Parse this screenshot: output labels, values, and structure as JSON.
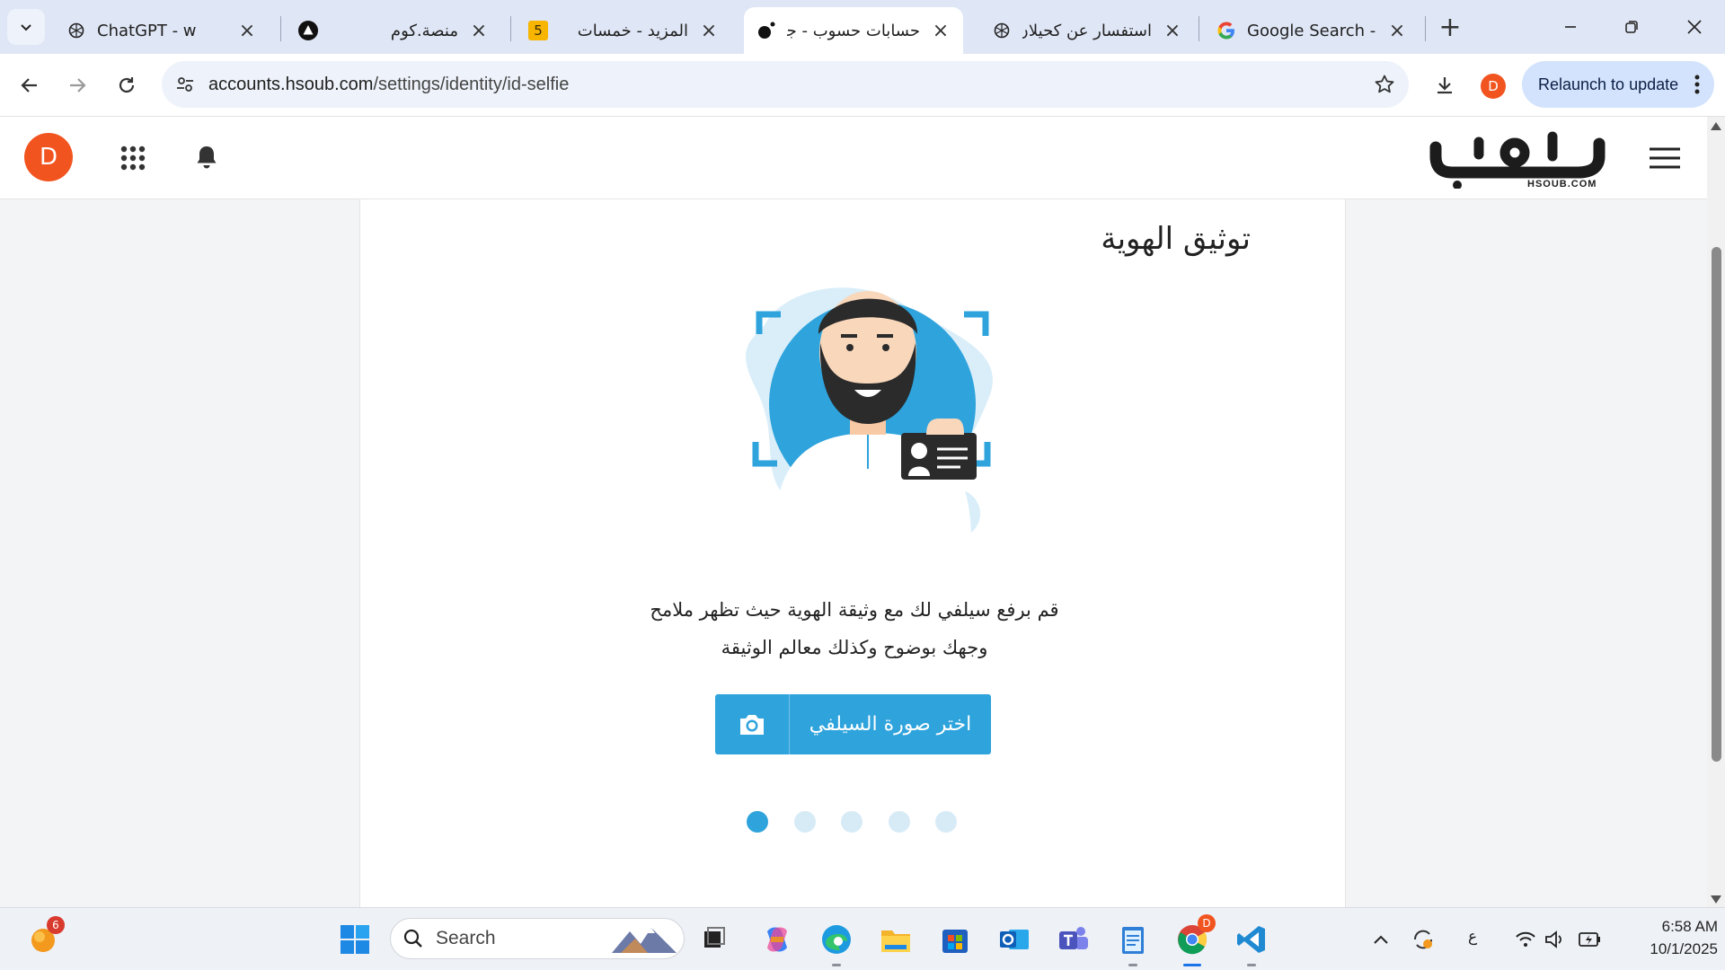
{
  "browser": {
    "tabs": [
      {
        "title": "ChatGPT - w",
        "favicon": "chatgpt-icon",
        "rtl": false,
        "active": false
      },
      {
        "title": "منصة.كوم",
        "favicon": "triangle-logo-icon",
        "rtl": true,
        "active": false
      },
      {
        "title": "المزيد - خمسات",
        "favicon": "khamsat-icon",
        "favicon_text": "5",
        "rtl": true,
        "active": false
      },
      {
        "title": "حسابات حسوب - جـ",
        "favicon": "hsoub-icon",
        "rtl": true,
        "active": true
      },
      {
        "title": "استفسار عن كحيلان",
        "favicon": "chatgpt-icon",
        "rtl": true,
        "active": false
      },
      {
        "title": "Google Search - ي",
        "favicon": "google-icon",
        "rtl": false,
        "active": false
      }
    ],
    "url_host": "accounts.hsoub.com",
    "url_path": "/settings/identity/id-selfie",
    "profile_initial": "D",
    "relaunch_label": "Relaunch to update",
    "accent": "#d3e3fd"
  },
  "site": {
    "user_initial": "D",
    "avatar_color": "#f1541f",
    "logo_text": "HSOUB.COM",
    "brand_color": "#2ea3dc"
  },
  "main": {
    "title": "توثيق الهوية",
    "description_line1": "قم برفع سيلفي لك مع وثيقة الهوية حيث تظهر ملامح",
    "description_line2": "وجهك بوضوح وكذلك معالم الوثيقة",
    "select_button_label": "اختر صورة السيلفي",
    "steps_total": 5,
    "current_step": 1
  },
  "taskbar": {
    "search_placeholder": "Search",
    "notification_badge": "6",
    "chrome_badge": "D",
    "language": "ع",
    "time": "6:58 AM",
    "date": "10/1/2025"
  }
}
